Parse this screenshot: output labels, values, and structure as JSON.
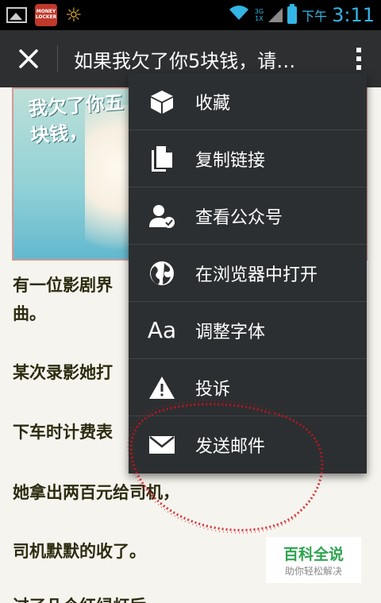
{
  "status_bar": {
    "app_badge_text": "MONEY LOCKER",
    "network": "3G",
    "network_sub": "1X",
    "ampm": "下午",
    "time": "3:11"
  },
  "title_bar": {
    "title": "如果我欠了你5块钱，请…"
  },
  "article": {
    "image_caption": "我欠了你五块钱，",
    "lines": [
      "有一位影剧界",
      "曲。",
      "某次录影她打",
      "下车时计费表",
      "她拿出两百元给司机，",
      "司机默默的收了。",
      "过了几个红绿灯后，"
    ]
  },
  "menu": {
    "items": [
      {
        "label": "收藏",
        "icon": "box-icon"
      },
      {
        "label": "复制链接",
        "icon": "copy-icon"
      },
      {
        "label": "查看公众号",
        "icon": "user-check-icon"
      },
      {
        "label": "在浏览器中打开",
        "icon": "globe-icon"
      },
      {
        "label": "调整字体",
        "icon": "font-size-icon",
        "glyph": "Aa"
      },
      {
        "label": "投诉",
        "icon": "warning-icon"
      },
      {
        "label": "发送邮件",
        "icon": "mail-icon"
      }
    ]
  },
  "watermark": {
    "title": "百科全说",
    "subtitle": "助你轻松解决"
  },
  "colors": {
    "menu_bg": "#2c2f31",
    "titlebar_bg": "#2e2f31",
    "accent_blue": "#33b5e5",
    "annotation_red": "#d0121a",
    "watermark_green": "#2da44e"
  }
}
